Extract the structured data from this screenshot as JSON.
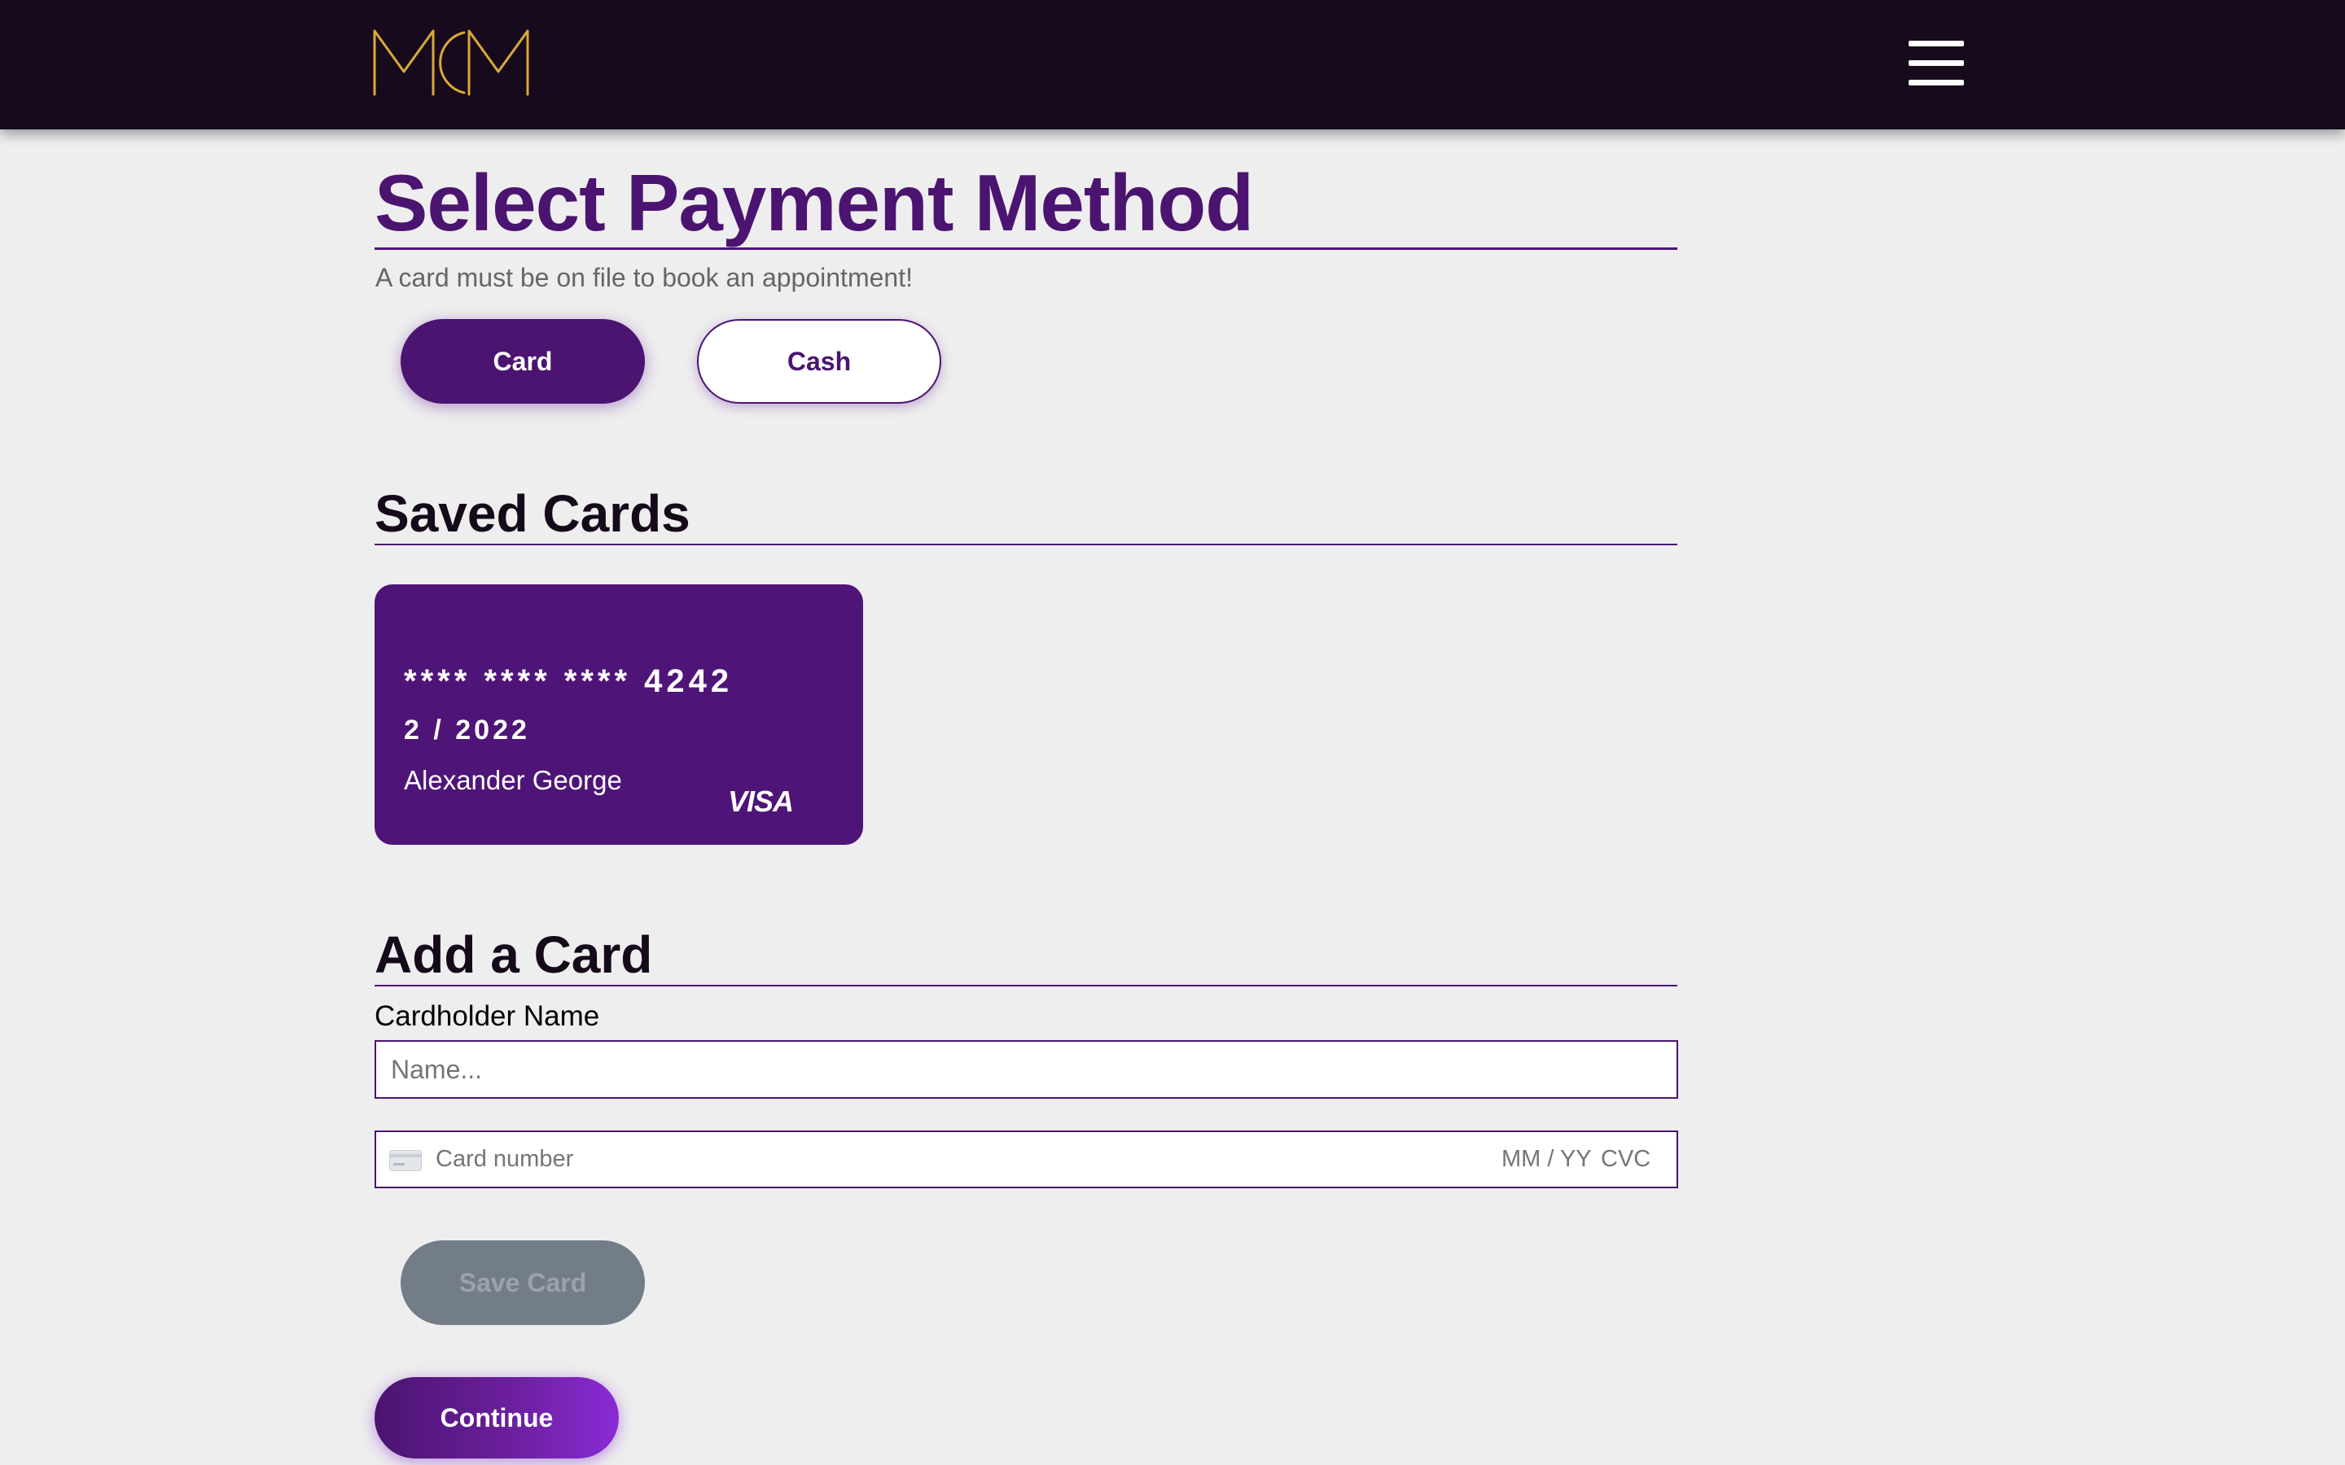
{
  "header": {
    "logo_text": "MCM",
    "menu_icon": "hamburger-menu-icon"
  },
  "payment": {
    "title": "Select Payment Method",
    "subtitle": "A card must be on file to book an appointment!",
    "methods": [
      {
        "label": "Card",
        "selected": true
      },
      {
        "label": "Cash",
        "selected": false
      }
    ]
  },
  "saved_cards": {
    "title": "Saved Cards",
    "cards": [
      {
        "number": "**** **** **** 4242",
        "expiry": "2 / 2022",
        "holder": "Alexander George",
        "brand": "VISA"
      }
    ]
  },
  "add_card": {
    "title": "Add a Card",
    "name_label": "Cardholder Name",
    "name_placeholder": "Name...",
    "card_number_placeholder": "Card number",
    "expiry_placeholder": "MM / YY",
    "cvc_placeholder": "CVC",
    "card_icon": "credit-card-icon",
    "save_label": "Save Card"
  },
  "continue_label": "Continue",
  "colors": {
    "header_bg": "#170a1c",
    "accent": "#4b1470",
    "logo_gold": "#d8a93a",
    "page_bg": "#eeeeee",
    "disabled_button": "#727d88"
  }
}
